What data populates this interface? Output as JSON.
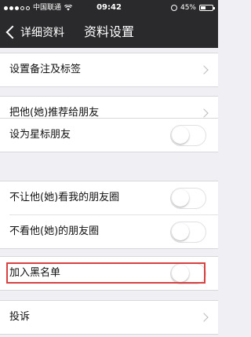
{
  "status_bar": {
    "carrier": "中国联通",
    "time": "09:42",
    "battery_text": "45%",
    "battery_level": 0.45
  },
  "nav": {
    "back_label": "详细资料",
    "title": "资料设置"
  },
  "settings": {
    "remark_label": "设置备注及标签",
    "recommend_label": "把他(她)推荐给朋友",
    "star_label": "设为星标朋友",
    "hide_my_moments_label": "不让他(她)看我的朋友圈",
    "hide_their_moments_label": "不看他(她)的朋友圈",
    "blacklist_label": "加入黑名单",
    "report_label": "投诉"
  },
  "toggles": {
    "star": false,
    "hide_my_moments": false,
    "hide_their_moments": false,
    "blacklist": false
  },
  "colors": {
    "nav_background": "#2a2a2c",
    "page_background": "#efeff4",
    "highlight_border": "#d94040"
  }
}
